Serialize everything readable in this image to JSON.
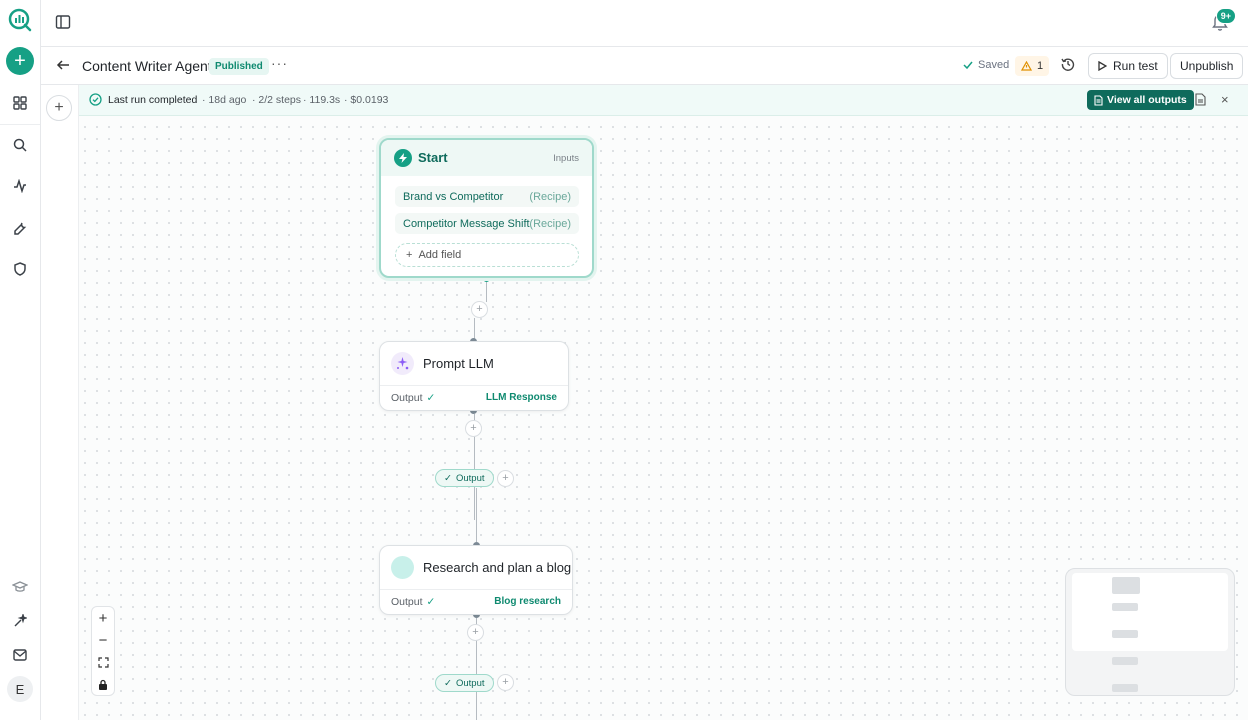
{
  "topbar": {
    "notifications_badge": "9+"
  },
  "header": {
    "back_label": "←",
    "agent_title": "Content Writer Agent",
    "status": "Published",
    "more": "···",
    "saved_label": "Saved",
    "warning_count": "1",
    "run_test_label": "Run test",
    "unpublish_label": "Unpublish"
  },
  "banner": {
    "status": "Last run completed",
    "ago": "· 18d ago",
    "steps": "· 2/2 steps",
    "duration": "· 119.3s",
    "cost": "· $0.0193",
    "view_all_label": "View all outputs",
    "close": "×"
  },
  "rail": {
    "avatar_initial": "E"
  },
  "start_node": {
    "title": "Start",
    "inputs_label": "Inputs",
    "fields": [
      {
        "name": "Brand vs Competitor",
        "type": "(Recipe)"
      },
      {
        "name": "Competitor Message Shift",
        "type": "(Recipe)"
      }
    ],
    "add_field_label": "Add field"
  },
  "steps": [
    {
      "title": "Prompt LLM",
      "output_label": "Output",
      "result": "LLM Response"
    },
    {
      "title": "Research and plan a blog",
      "output_label": "Output",
      "result": "Blog research"
    }
  ],
  "output_pills": [
    "Output",
    "Output"
  ],
  "colors": {
    "accent": "#16a085",
    "accent_dark": "#0f6b5c",
    "warning": "#f0a020"
  }
}
